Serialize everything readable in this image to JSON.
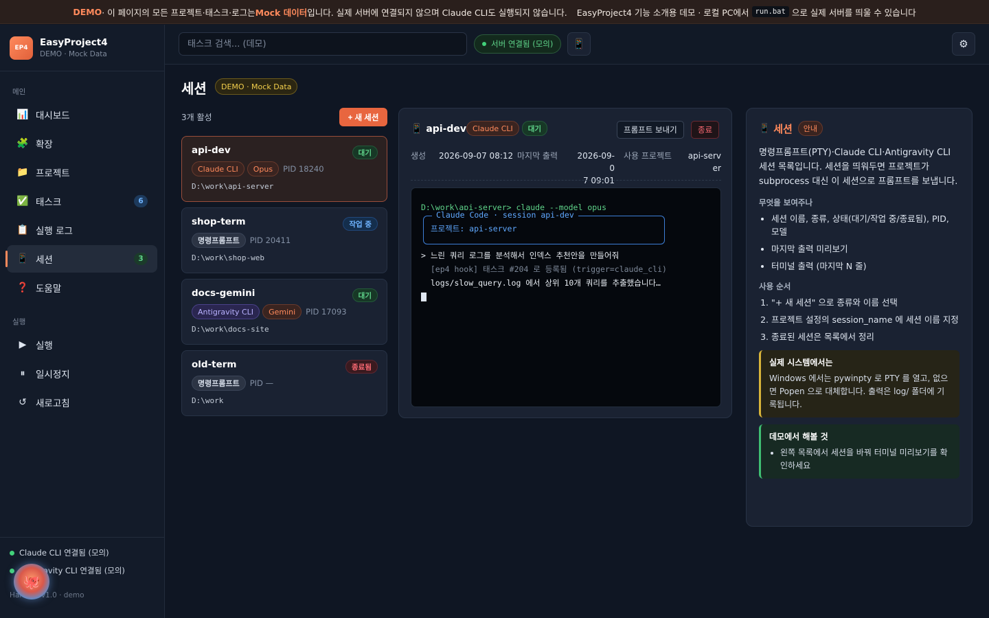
{
  "banner": {
    "demo": "DEMO",
    "text1": "· 이 페이지의 모든 프로젝트·태스크·로그는 ",
    "mock": "Mock 데이터",
    "text2": "입니다. 실제 서버에 연결되지 않으며 Claude CLI도 실행되지 않습니다.",
    "text3": "EasyProject4 기능 소개용 데모 · 로컬 PC에서",
    "code": "run.bat",
    "text4": "으로 실제 서버를 띄울 수 있습니다"
  },
  "brand": {
    "logo": "EP4",
    "name": "EasyProject4",
    "sub": "DEMO · Mock Data"
  },
  "sidebar": {
    "section_main": "메인",
    "section_run": "실행",
    "items": [
      {
        "label": "대시보드",
        "icon": "📊",
        "icon_name": "chart-icon"
      },
      {
        "label": "확장",
        "icon": "🧩",
        "icon_name": "puzzle-icon"
      },
      {
        "label": "프로젝트",
        "icon": "📁",
        "icon_name": "folder-icon"
      },
      {
        "label": "태스크",
        "icon": "✅",
        "icon_name": "check-icon",
        "badge": "6"
      },
      {
        "label": "실행 로그",
        "icon": "📋",
        "icon_name": "clipboard-icon"
      },
      {
        "label": "세션",
        "icon": "📱",
        "icon_name": "terminal-icon",
        "badge": "3"
      },
      {
        "label": "도움말",
        "icon": "❓",
        "icon_name": "help-icon"
      }
    ],
    "run_items": [
      {
        "label": "실행",
        "icon": "▶",
        "icon_name": "play-icon"
      },
      {
        "label": "일시정지",
        "icon": "⏸",
        "icon_name": "pause-icon"
      },
      {
        "label": "새로고침",
        "icon": "↺",
        "icon_name": "refresh-icon"
      }
    ],
    "footer": {
      "conn1": "Claude CLI 연결됨  (모의)",
      "conn2": "Antigravity CLI 연결됨  (모의)",
      "version": "Harness v1.0 · demo"
    }
  },
  "topbar": {
    "search_placeholder": "태스크 검색... (데모)",
    "server": "서버 연결됨 (모의)"
  },
  "page": {
    "title": "세션",
    "demo_pill": "DEMO · Mock Data",
    "active_count": "3개 활성",
    "new_button": "+ 새 세션"
  },
  "sessions": [
    {
      "name": "api-dev",
      "status": "대기",
      "tags": [
        "Claude CLI",
        "Opus"
      ],
      "pid": "PID 18240",
      "path": "D:\\work\\api-server"
    },
    {
      "name": "shop-term",
      "status": "작업 중",
      "tags": [
        "명령프롬프트"
      ],
      "pid": "PID 20411",
      "path": "D:\\work\\shop-web"
    },
    {
      "name": "docs-gemini",
      "status": "대기",
      "tags": [
        "Antigravity CLI",
        "Gemini"
      ],
      "pid": "PID 17093",
      "path": "D:\\work\\docs-site"
    },
    {
      "name": "old-term",
      "status": "종료됨",
      "tags": [
        "명령프롬프트"
      ],
      "pid": "PID —",
      "path": "D:\\work"
    }
  ],
  "detail": {
    "title": "api-dev",
    "tag1": "Claude CLI",
    "status": "대기",
    "send_prompt": "프롬프트 보내기",
    "end": "종료",
    "created_label": "생성",
    "created_value": "2026-09-07 08:12",
    "last_output_label": "마지막 출력",
    "last_output_value_1": "2026-09-0",
    "last_output_value_2": "7 09:01",
    "project_label": "사용 프로젝트",
    "project_value_1": "api-serv",
    "project_value_2": "er",
    "terminal": {
      "cmd": "D:\\work\\api-server> claude --model opus",
      "box_title": "Claude Code · session api-dev",
      "box_body": "프로젝트: api-server",
      "prompt": "> 느린 쿼리 로그를 분석해서 인덱스 추천안을 만들어줘",
      "hook": "  [ep4 hook] 태스크 #204 로 등록됨 (trigger=claude_cli)",
      "output": "  logs/slow_query.log 에서 상위 10개 쿼리를 추출했습니다…"
    }
  },
  "guide": {
    "title": "세션",
    "pill": "안내",
    "intro": "명령프롬프트(PTY)·Claude CLI·Antigravity CLI 세션 목록입니다. 세션을 띄워두면 프로젝트가 subprocess 대신 이 세션으로 프롬프트를 보냅니다.",
    "what_title": "무엇을 보여주나",
    "what": [
      "세션 이름, 종류, 상태(대기/작업 중/종료됨), PID, 모델",
      "마지막 출력 미리보기",
      "터미널 출력 (마지막 N 줄)"
    ],
    "how_title": "사용 순서",
    "how": [
      "\"+ 새 세션\" 으로 종류와 이름 선택",
      "프로젝트 설정의 session_name 에 세션 이름 지정",
      "종료된 세션은 목록에서 정리"
    ],
    "real_title": "실제 시스템에서는",
    "real_body": "Windows 에서는 pywinpty 로 PTY 를 열고, 없으면 Popen 으로 대체합니다. 출력은 log/ 폴더에 기록됩니다.",
    "try_title": "데모에서 해볼 것",
    "try": [
      "왼쪽 목록에서 세션을 바꿔 터미널 미리보기를 확인하세요"
    ]
  },
  "colors": {
    "accent": "#ff8a5c",
    "success": "#42d17a",
    "info": "#6fb4ff",
    "danger": "#ff6b75"
  }
}
